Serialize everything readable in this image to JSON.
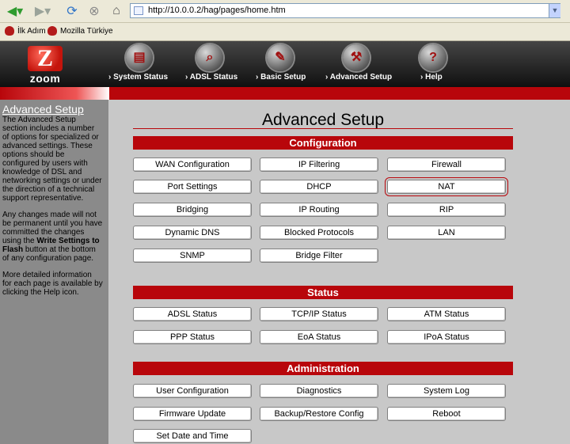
{
  "browser": {
    "url": "http://10.0.0.2/hag/pages/home.htm",
    "bookmarks": [
      "İlk Adım",
      "Mozilla Türkiye"
    ]
  },
  "brand": {
    "logo_text": "zoom",
    "logo_mark": "Z"
  },
  "nav": [
    {
      "label": "System Status",
      "icon": "folder-icon"
    },
    {
      "label": "ADSL Status",
      "icon": "magnifier-icon"
    },
    {
      "label": "Basic Setup",
      "icon": "plug-icon"
    },
    {
      "label": "Advanced Setup",
      "icon": "wrench-icon"
    },
    {
      "label": "Help",
      "icon": "help-icon"
    }
  ],
  "sidebar": {
    "title": "Advanced Setup",
    "para1": "The Advanced Setup section includes a number of options for specialized or advanced settings. These options should be configured by users with knowledge of DSL and networking settings or under the direction of a technical support representative.",
    "para2_pre": "Any changes made will not be permanent until you have committed the changes using the ",
    "para2_bold": "Write Settings to Flash",
    "para2_post": " button at the bottom of any configuration page.",
    "para3": "More detailed information for each page is available by clicking the Help icon."
  },
  "page": {
    "title": "Advanced Setup"
  },
  "sections": {
    "configuration": {
      "title": "Configuration",
      "buttons": [
        "WAN Configuration",
        "IP Filtering",
        "Firewall",
        "Port Settings",
        "DHCP",
        "NAT",
        "Bridging",
        "IP Routing",
        "RIP",
        "Dynamic DNS",
        "Blocked Protocols",
        "LAN",
        "SNMP",
        "Bridge Filter"
      ]
    },
    "status": {
      "title": "Status",
      "buttons": [
        "ADSL Status",
        "TCP/IP Status",
        "ATM Status",
        "PPP Status",
        "EoA Status",
        "IPoA Status"
      ]
    },
    "administration": {
      "title": "Administration",
      "buttons": [
        "User Configuration",
        "Diagnostics",
        "System Log",
        "Firmware Update",
        "Backup/Restore Config",
        "Reboot",
        "Set Date and Time"
      ]
    }
  }
}
